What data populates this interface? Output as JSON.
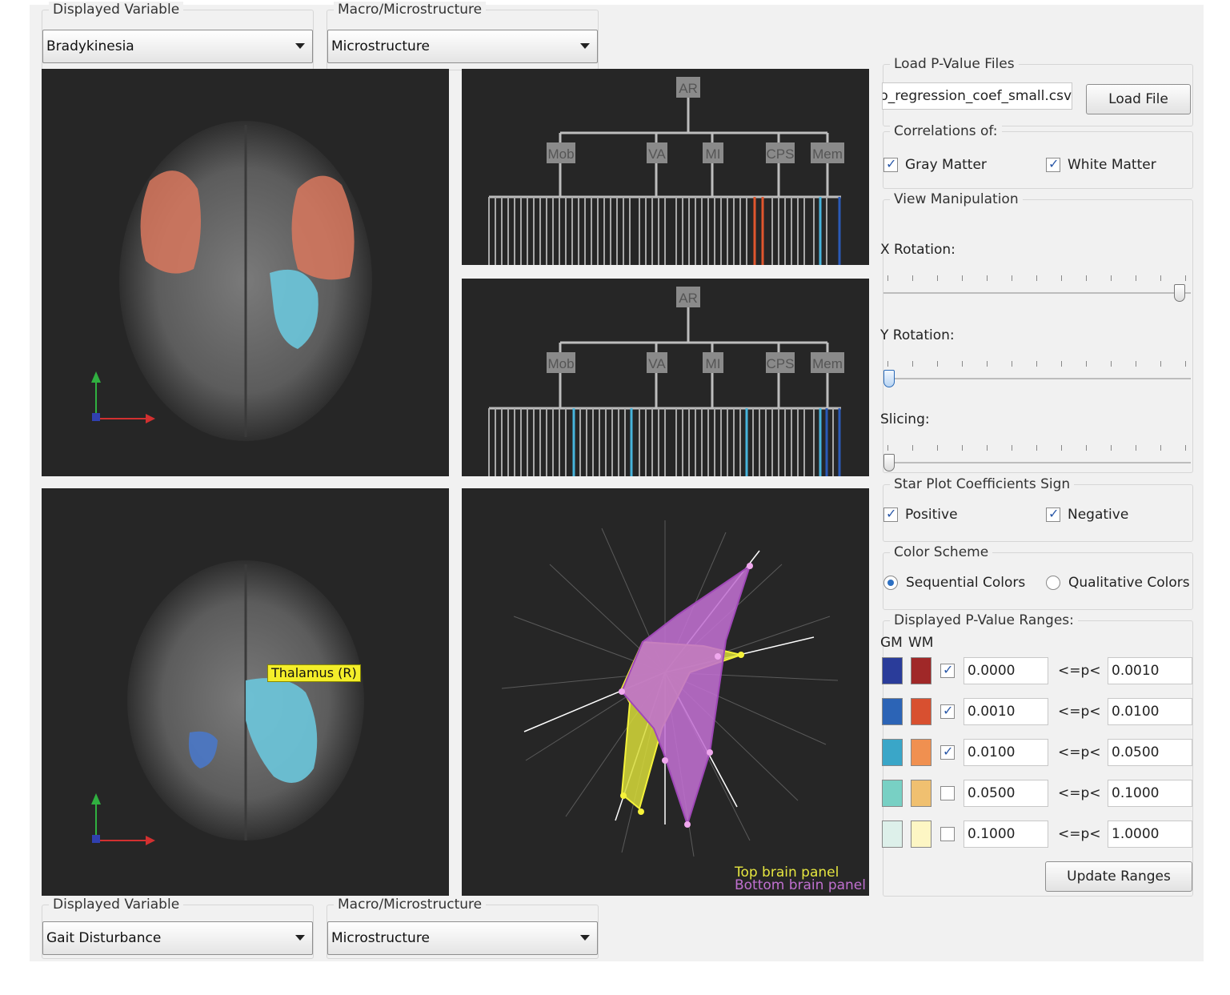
{
  "top_controls": {
    "displayed_variable": {
      "title": "Displayed Variable",
      "value": "Bradykinesia"
    },
    "macro_micro": {
      "title": "Macro/Microstructure",
      "value": "Microstructure"
    }
  },
  "bottom_controls": {
    "displayed_variable": {
      "title": "Displayed Variable",
      "value": "Gait Disturbance"
    },
    "macro_micro": {
      "title": "Macro/Microstructure",
      "value": "Microstructure"
    }
  },
  "brain_bottom": {
    "region_label": "Thalamus (R)"
  },
  "tree": {
    "root": "AR",
    "groups": [
      "Mob",
      "VA",
      "MI",
      "CPS",
      "Mem"
    ]
  },
  "star_plot": {
    "legend_top": "Top brain panel",
    "legend_bottom": "Bottom brain panel",
    "top_color": "#e6e640",
    "bottom_color": "#c070d0"
  },
  "side_panel": {
    "load": {
      "title": "Load P-Value Files",
      "file": "o_regression_coef_small.csv",
      "button": "Load File"
    },
    "correlations": {
      "title": "Correlations of:",
      "gray": "Gray Matter",
      "white": "White Matter",
      "gray_checked": true,
      "white_checked": true
    },
    "view": {
      "title": "View Manipulation",
      "x_label": "X Rotation:",
      "y_label": "Y Rotation:",
      "slicing_label": "Slicing:",
      "x_value": 1.0,
      "y_value": 0.0,
      "slicing_value": 0.0
    },
    "star_sign": {
      "title": "Star Plot Coefficients Sign",
      "positive": "Positive",
      "negative": "Negative",
      "positive_checked": true,
      "negative_checked": true
    },
    "color_scheme": {
      "title": "Color Scheme",
      "sequential": "Sequential Colors",
      "qualitative": "Qualitative Colors",
      "selected": "sequential"
    },
    "ranges": {
      "title": "Displayed P-Value Ranges:",
      "gm_header": "GM",
      "wm_header": "WM",
      "operator": "<=p<",
      "rows": [
        {
          "gm": "#2a3c9a",
          "wm": "#a02828",
          "checked": true,
          "low": "0.0000",
          "high": "0.0010"
        },
        {
          "gm": "#2c64b6",
          "wm": "#d85030",
          "checked": true,
          "low": "0.0010",
          "high": "0.0100"
        },
        {
          "gm": "#3aa6c8",
          "wm": "#f09050",
          "checked": true,
          "low": "0.0100",
          "high": "0.0500"
        },
        {
          "gm": "#78d0c4",
          "wm": "#f0c070",
          "checked": false,
          "low": "0.0500",
          "high": "0.1000"
        },
        {
          "gm": "#ddf0ea",
          "wm": "#fdf6c4",
          "checked": false,
          "low": "0.1000",
          "high": "1.0000"
        }
      ],
      "button": "Update Ranges"
    }
  }
}
